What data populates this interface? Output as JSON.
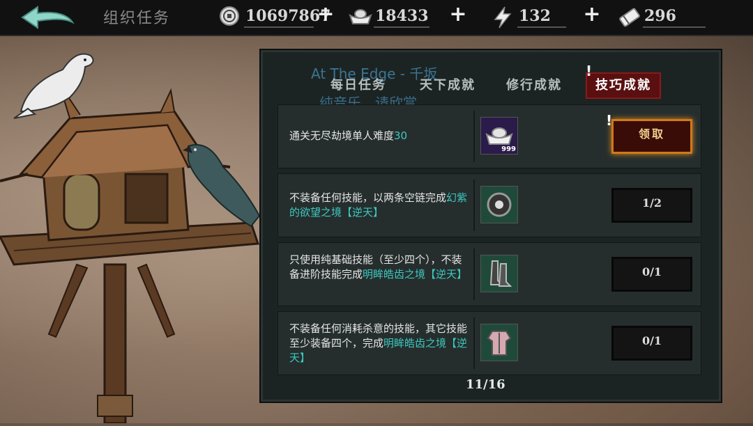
{
  "header": {
    "title": "组织任务"
  },
  "resources": [
    {
      "name": "copper-coin",
      "value": "10697867"
    },
    {
      "name": "silver-ingot",
      "value": "18433"
    },
    {
      "name": "energy",
      "value": "132"
    },
    {
      "name": "ticket",
      "value": "296"
    }
  ],
  "overlay": {
    "song_title": "At The Edge - 千坂",
    "song_sub": "纯音乐，请欣赏"
  },
  "tabs": [
    {
      "label": "每日任务"
    },
    {
      "label": "天下成就"
    },
    {
      "label": "修行成就"
    },
    {
      "label": "技巧成就"
    }
  ],
  "tasks": [
    {
      "desc_plain": "通关无尽劫境单人难度",
      "desc_hl": "30",
      "item_count": "999",
      "action": "领取"
    },
    {
      "desc_plain": "不装备任何技能，以两条空链完成",
      "desc_hl": "幻紫的欲望之境【逆天】",
      "progress": "1/2"
    },
    {
      "desc_plain": "只使用纯基础技能（至少四个），不装备进阶技能完成",
      "desc_hl": "明眸皓齿之境【逆天】",
      "progress": "0/1"
    },
    {
      "desc_plain": "不装备任何消耗杀意的技能，其它技能至少装备四个，完成",
      "desc_hl": "明眸皓齿之境【逆天】",
      "progress": "0/1"
    }
  ],
  "pager": "11/16",
  "colors": {
    "highlight": "#3ec8c0",
    "claim_border": "#d07a1a",
    "active_tab": "#5a0f10"
  }
}
